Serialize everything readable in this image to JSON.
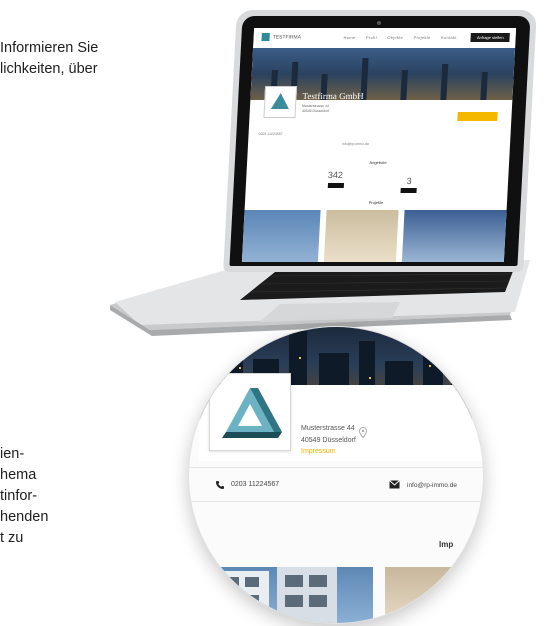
{
  "intro_text": "Informieren Sie",
  "intro_text_2": "lichkeiten, über",
  "side_text": [
    "ien-",
    "hema",
    "tinfor-",
    "henden",
    "t zu"
  ],
  "laptop": {
    "logo": "TESTFIRMA",
    "nav": [
      "Home",
      "Profil",
      "Objekte",
      "Projekte",
      "Kontakt"
    ],
    "cta": "Anfrage stellen",
    "company": "Testfirma GmbH",
    "section_offers": "Angebote",
    "count_left": "342",
    "count_right": "3",
    "section_projects": "Projekte"
  },
  "zoom": {
    "company_name": "Testfirma GmbH",
    "street": "Musterstrasse 44",
    "city": "40549 Düsseldorf",
    "imprint_link": "Impressum",
    "phone": "0203 11224567",
    "email": "info@rp-immo.de",
    "section_heading": "Imp"
  },
  "colors": {
    "accent": "#f0b400",
    "logo_teal": "#3c8d9c"
  }
}
